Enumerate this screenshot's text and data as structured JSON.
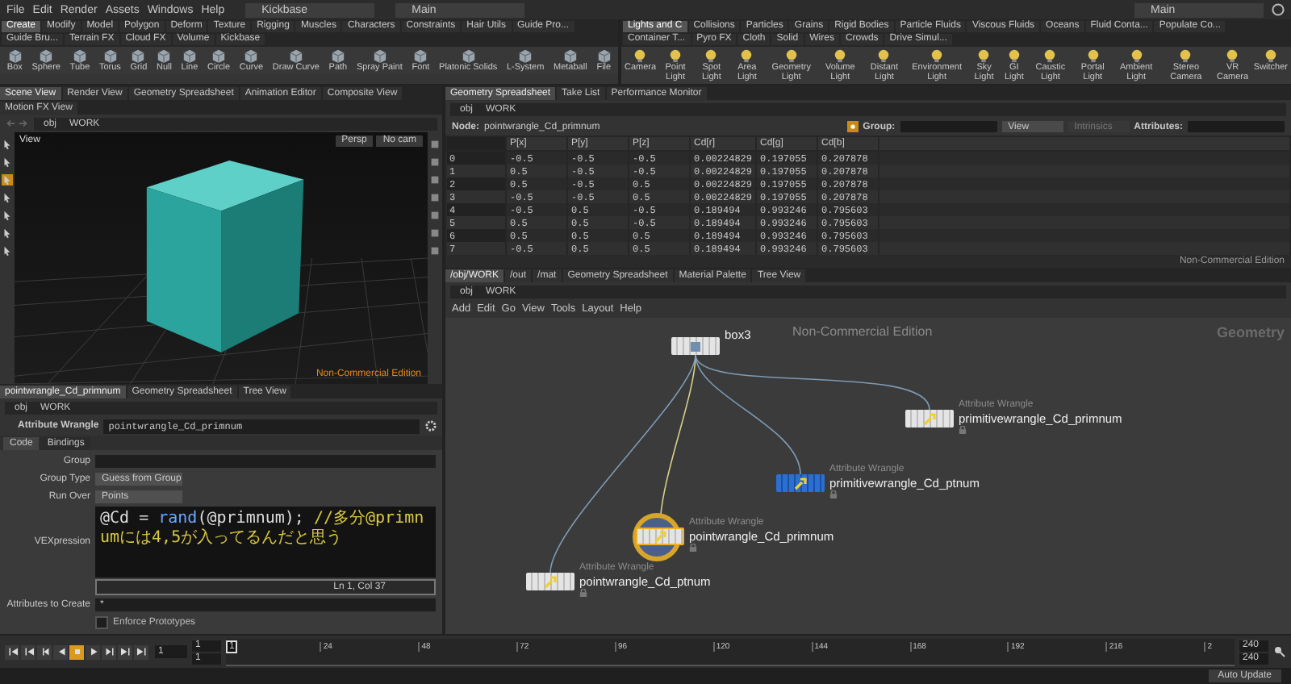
{
  "menu": [
    "File",
    "Edit",
    "Render",
    "Assets",
    "Windows",
    "Help"
  ],
  "desktops": [
    "Kickbase",
    "Main"
  ],
  "top_right_desktop": "Main",
  "shelves": [
    {
      "tabs": [
        {
          "label": "Create",
          "selected": true
        },
        {
          "label": "Modify",
          "selected": false
        },
        {
          "label": "Model",
          "selected": false
        },
        {
          "label": "Polygon",
          "selected": false
        },
        {
          "label": "Deform",
          "selected": false
        },
        {
          "label": "Texture",
          "selected": false
        },
        {
          "label": "Rigging",
          "selected": false
        },
        {
          "label": "Muscles",
          "selected": false
        },
        {
          "label": "Characters",
          "selected": false
        },
        {
          "label": "Constraints",
          "selected": false
        },
        {
          "label": "Hair Utils",
          "selected": false
        },
        {
          "label": "Guide Pro...",
          "selected": false
        },
        {
          "label": "Guide Bru...",
          "selected": false
        },
        {
          "label": "Terrain FX",
          "selected": false
        },
        {
          "label": "Cloud FX",
          "selected": false
        },
        {
          "label": "Volume",
          "selected": false
        },
        {
          "label": "Kickbase",
          "selected": false
        }
      ],
      "tools": [
        "Box",
        "Sphere",
        "Tube",
        "Torus",
        "Grid",
        "Null",
        "Line",
        "Circle",
        "Curve",
        "Draw Curve",
        "Path",
        "Spray Paint",
        "Font",
        "Platonic Solids",
        "L-System",
        "Metaball",
        "File"
      ]
    },
    {
      "tabs": [
        {
          "label": "Lights and C",
          "selected": true
        },
        {
          "label": "Collisions",
          "selected": false
        },
        {
          "label": "Particles",
          "selected": false
        },
        {
          "label": "Grains",
          "selected": false
        },
        {
          "label": "Rigid Bodies",
          "selected": false
        },
        {
          "label": "Particle Fluids",
          "selected": false
        },
        {
          "label": "Viscous Fluids",
          "selected": false
        },
        {
          "label": "Oceans",
          "selected": false
        },
        {
          "label": "Fluid Conta...",
          "selected": false
        },
        {
          "label": "Populate Co...",
          "selected": false
        },
        {
          "label": "Container T...",
          "selected": false
        },
        {
          "label": "Pyro FX",
          "selected": false
        },
        {
          "label": "Cloth",
          "selected": false
        },
        {
          "label": "Solid",
          "selected": false
        },
        {
          "label": "Wires",
          "selected": false
        },
        {
          "label": "Crowds",
          "selected": false
        },
        {
          "label": "Drive Simul...",
          "selected": false
        }
      ],
      "tools": [
        "Camera",
        "Point Light",
        "Spot Light",
        "Area Light",
        "Geometry Light",
        "Volume Light",
        "Distant Light",
        "Environment Light",
        "Sky Light",
        "GI Light",
        "Caustic Light",
        "Portal Light",
        "Ambient Light",
        "Stereo Camera",
        "VR Camera",
        "Switcher"
      ]
    }
  ],
  "scene_pane": {
    "tabs": [
      {
        "label": "Scene View",
        "selected": true
      },
      {
        "label": "Render View",
        "selected": false
      },
      {
        "label": "Geometry Spreadsheet",
        "selected": false
      },
      {
        "label": "Animation Editor",
        "selected": false
      },
      {
        "label": "Composite View",
        "selected": false
      },
      {
        "label": "Motion FX View",
        "selected": false
      }
    ],
    "path": [
      "obj",
      "WORK"
    ],
    "viewport_title": "View",
    "camera_menus": [
      "Persp",
      "No cam"
    ],
    "watermark": "Non-Commercial Edition"
  },
  "param_pane": {
    "tabs": [
      {
        "label": "pointwrangle_Cd_primnum",
        "selected": true
      },
      {
        "label": "Geometry Spreadsheet",
        "selected": false
      },
      {
        "label": "Tree View",
        "selected": false
      }
    ],
    "path": [
      "obj",
      "WORK"
    ],
    "node_type": "Attribute Wrangle",
    "node_name": "pointwrangle_Cd_primnum",
    "sub_tabs": [
      {
        "label": "Code",
        "selected": true
      },
      {
        "label": "Bindings",
        "selected": false
      }
    ],
    "params": [
      {
        "kind": "field",
        "label": "Group"
      },
      {
        "kind": "menu",
        "label": "Group Type",
        "value": "Guess from Group"
      },
      {
        "kind": "menu",
        "label": "Run Over",
        "value": "Points"
      },
      {
        "kind": "code",
        "label": "VEXpression",
        "cursor": "Ln 1, Col 37",
        "tokens": [
          {
            "kind": "plain",
            "text": "@Cd = "
          },
          {
            "kind": "function",
            "text": "rand"
          },
          {
            "kind": "plain",
            "text": "(@primnum); "
          },
          {
            "kind": "comment",
            "text": "//多分@primnumには4,5が入ってるんだと思う"
          }
        ]
      },
      {
        "kind": "field",
        "label": "Attributes to Create",
        "value": "*"
      },
      {
        "kind": "checkbox",
        "label": "Enforce Prototypes",
        "checked": false
      }
    ]
  },
  "spreadsheet_pane": {
    "tabs": [
      {
        "label": "Geometry Spreadsheet",
        "selected": true
      },
      {
        "label": "Take List",
        "selected": false
      },
      {
        "label": "Performance Monitor",
        "selected": false
      }
    ],
    "path": [
      "obj",
      "WORK"
    ],
    "node_label": "Node:",
    "node_name": "pointwrangle_Cd_primnum",
    "group_label": "Group:",
    "view_menu": "View",
    "intrinsics_menu": "Intrinsics",
    "attributes_label": "Attributes:",
    "columns": [
      "",
      "P[x]",
      "P[y]",
      "P[z]",
      "Cd[r]",
      "Cd[g]",
      "Cd[b]"
    ],
    "rows": [
      [
        "0",
        "-0.5",
        "-0.5",
        "-0.5",
        "0.00224829",
        "0.197055",
        "0.207878"
      ],
      [
        "1",
        "0.5",
        "-0.5",
        "-0.5",
        "0.00224829",
        "0.197055",
        "0.207878"
      ],
      [
        "2",
        "0.5",
        "-0.5",
        "0.5",
        "0.00224829",
        "0.197055",
        "0.207878"
      ],
      [
        "3",
        "-0.5",
        "-0.5",
        "0.5",
        "0.00224829",
        "0.197055",
        "0.207878"
      ],
      [
        "4",
        "-0.5",
        "0.5",
        "-0.5",
        "0.189494",
        "0.993246",
        "0.795603"
      ],
      [
        "5",
        "0.5",
        "0.5",
        "-0.5",
        "0.189494",
        "0.993246",
        "0.795603"
      ],
      [
        "6",
        "0.5",
        "0.5",
        "0.5",
        "0.189494",
        "0.993246",
        "0.795603"
      ],
      [
        "7",
        "-0.5",
        "0.5",
        "0.5",
        "0.189494",
        "0.993246",
        "0.795603"
      ]
    ],
    "watermark": "Non-Commercial Edition"
  },
  "network_pane": {
    "tabs": [
      {
        "label": "/obj/WORK",
        "selected": true
      },
      {
        "label": "/out",
        "selected": false
      },
      {
        "label": "/mat",
        "selected": false
      },
      {
        "label": "Geometry Spreadsheet",
        "selected": false
      },
      {
        "label": "Material Palette",
        "selected": false
      },
      {
        "label": "Tree View",
        "selected": false
      }
    ],
    "path": [
      "obj",
      "WORK"
    ],
    "menu": [
      "Add",
      "Edit",
      "Go",
      "View",
      "Tools",
      "Layout",
      "Help"
    ],
    "watermark": "Non-Commercial Edition",
    "context": "Geometry",
    "nodes": [
      {
        "name": "box3",
        "display": false,
        "selected": false
      },
      {
        "type_label": "Attribute Wrangle",
        "name": "primitivewrangle_Cd_primnum",
        "display": false,
        "selected": false
      },
      {
        "type_label": "Attribute Wrangle",
        "name": "primitivewrangle_Cd_ptnum",
        "display": true,
        "selected": false
      },
      {
        "type_label": "Attribute Wrangle",
        "name": "pointwrangle_Cd_primnum",
        "display": false,
        "selected": true
      },
      {
        "type_label": "Attribute Wrangle",
        "name": "pointwrangle_Cd_ptnum",
        "display": false,
        "selected": false
      }
    ]
  },
  "timeline": {
    "transport": [
      {
        "kind": "start",
        "selected": false
      },
      {
        "kind": "prev-key",
        "selected": false
      },
      {
        "kind": "step-back",
        "selected": false
      },
      {
        "kind": "reverse",
        "selected": false
      },
      {
        "kind": "stop",
        "selected": true
      },
      {
        "kind": "play",
        "selected": false
      },
      {
        "kind": "step-forward",
        "selected": false
      },
      {
        "kind": "next-key",
        "selected": false
      },
      {
        "kind": "end",
        "selected": false
      }
    ],
    "frame": "1",
    "range_start": [
      "1",
      "1"
    ],
    "current_marker": "1",
    "ticks": [
      "24",
      "48",
      "72",
      "96",
      "120",
      "144",
      "168",
      "192",
      "216",
      "2"
    ],
    "range_end": [
      "240",
      "240"
    ]
  },
  "status_bar": {
    "auto_update": "Auto Update"
  }
}
